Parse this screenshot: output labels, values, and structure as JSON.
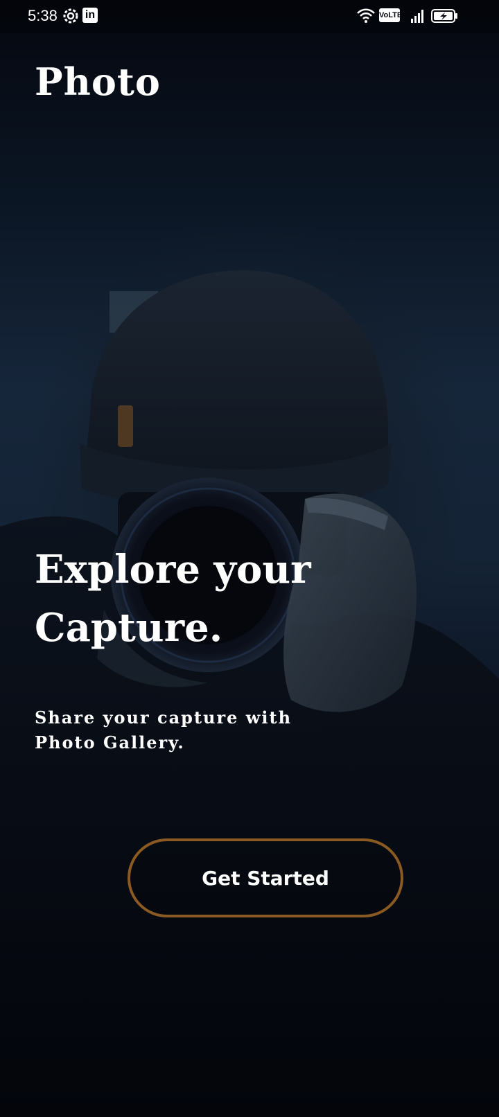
{
  "status_bar": {
    "time": "5:38",
    "icons": [
      "settings-icon",
      "linkedin-icon",
      "wifi-icon",
      "volte-icon",
      "signal-icon",
      "battery-charging-icon"
    ],
    "volte_label": "VoLTE",
    "linkedin_label": "in"
  },
  "app": {
    "title": "Photo"
  },
  "hero": {
    "headline_line1": "Explore your",
    "headline_line2": "Capture.",
    "subtitle_line1": "Share your capture with",
    "subtitle_line2": "Photo Gallery."
  },
  "cta": {
    "label": "Get Started",
    "border_color": "#8a5a22"
  },
  "colors": {
    "background": "#05070f",
    "text": "#ffffff",
    "accent": "#8a5a22"
  }
}
